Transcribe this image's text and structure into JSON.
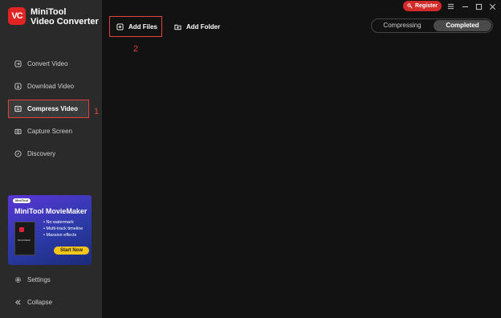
{
  "app": {
    "logo": "VC",
    "name_line1": "MiniTool",
    "name_line2": "Video Converter"
  },
  "sidebar": {
    "items": [
      {
        "label": "Convert Video",
        "icon": "convert-icon"
      },
      {
        "label": "Download Video",
        "icon": "download-icon"
      },
      {
        "label": "Compress Video",
        "icon": "compress-icon",
        "active": true
      },
      {
        "label": "Capture Screen",
        "icon": "camera-icon"
      },
      {
        "label": "Discovery",
        "icon": "compass-icon"
      }
    ],
    "settings_label": "Settings",
    "collapse_label": "Collapse"
  },
  "ad": {
    "badge": "MiniTool",
    "title": "MiniTool MovieMaker",
    "box_label": "MovieMaker",
    "features": [
      "No watermark",
      "Multi-track timeline",
      "Massive effects"
    ],
    "cta": "Start Now"
  },
  "toolbar": {
    "add_files": "Add Files",
    "add_folder": "Add Folder"
  },
  "tabs": {
    "compressing": "Compressing",
    "completed": "Completed"
  },
  "titlebar": {
    "register": "Register"
  },
  "annotations": {
    "step1": "1",
    "step2": "2"
  },
  "colors": {
    "accent": "#e0413a",
    "sidebar_bg": "#2a2a2a",
    "main_bg": "#121212"
  }
}
